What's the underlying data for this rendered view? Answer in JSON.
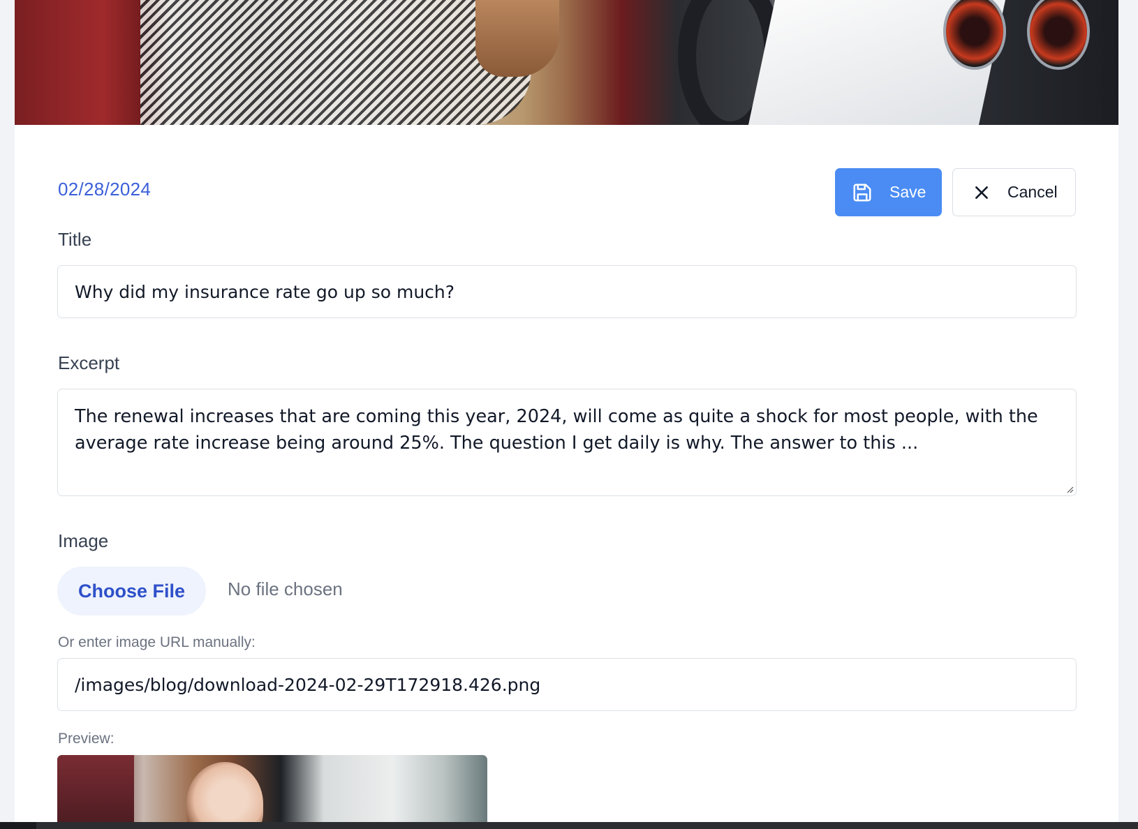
{
  "post": {
    "date": "02/28/2024",
    "title_label": "Title",
    "title_value": "Why did my insurance rate go up so much?",
    "excerpt_label": "Excerpt",
    "excerpt_value": "The renewal increases that are coming this year, 2024, will come as quite a shock for most people, with the average rate increase being around 25%. The question I get daily is why. The answer to this ...",
    "image_label": "Image",
    "choose_file_label": "Choose File",
    "no_file_text": "No file chosen",
    "url_label": "Or enter image URL manually:",
    "url_value": "/images/blog/download-2024-02-29T172918.426.png",
    "preview_label": "Preview:"
  },
  "actions": {
    "save_label": "Save",
    "cancel_label": "Cancel"
  },
  "icons": {
    "save": "save-floppy-icon",
    "cancel": "close-icon"
  },
  "colors": {
    "accent": "#4a8cf3",
    "date": "#3b5fd9",
    "choose_file_text": "#2e50c9",
    "choose_file_bg": "#eef3fd"
  }
}
